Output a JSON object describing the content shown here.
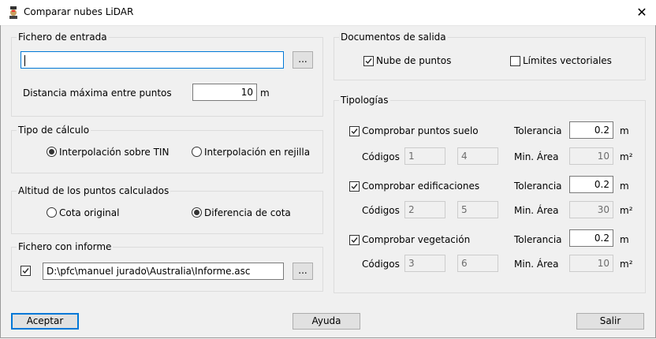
{
  "window": {
    "title": "Comparar nubes LiDAR",
    "close_glyph": "✕"
  },
  "entrada": {
    "legend": "Fichero de entrada",
    "file_value": "",
    "browse_label": "...",
    "dist_label": "Distancia máxima entre puntos",
    "dist_value": "10",
    "dist_unit": "m"
  },
  "calculo": {
    "legend": "Tipo de cálculo",
    "option_tin": "Interpolación sobre TIN",
    "option_rejilla": "Interpolación en rejilla",
    "selected": "tin"
  },
  "altitud": {
    "legend": "Altitud de los puntos calculados",
    "option_original": "Cota original",
    "option_diferencia": "Diferencia de cota",
    "selected": "diferencia"
  },
  "informe": {
    "legend": "Fichero con informe",
    "checked": true,
    "path": "D:\\pfc\\manuel jurado\\Australia\\Informe.asc",
    "browse_label": "..."
  },
  "salida": {
    "legend": "Documentos de salida",
    "nube_label": "Nube de puntos",
    "nube_checked": true,
    "limites_label": "Límites vectoriales",
    "limites_checked": false
  },
  "tipologias": {
    "legend": "Tipologías",
    "tolerancia_label": "Tolerancia",
    "codigos_label": "Códigos",
    "minarea_label": "Min. Área",
    "unit_m": "m",
    "unit_m2": "m²",
    "rows": [
      {
        "label": "Comprobar puntos suelo",
        "checked": true,
        "tolerancia": "0.2",
        "codigo1": "1",
        "codigo2": "4",
        "min_area": "10"
      },
      {
        "label": "Comprobar edificaciones",
        "checked": true,
        "tolerancia": "0.2",
        "codigo1": "2",
        "codigo2": "5",
        "min_area": "30"
      },
      {
        "label": "Comprobar vegetación",
        "checked": true,
        "tolerancia": "0.2",
        "codigo1": "3",
        "codigo2": "6",
        "min_area": "10"
      }
    ]
  },
  "buttons": {
    "aceptar": "Aceptar",
    "ayuda": "Ayuda",
    "salir": "Salir"
  },
  "colors": {
    "accent": "#0078d7",
    "background": "#f0f0f0"
  }
}
